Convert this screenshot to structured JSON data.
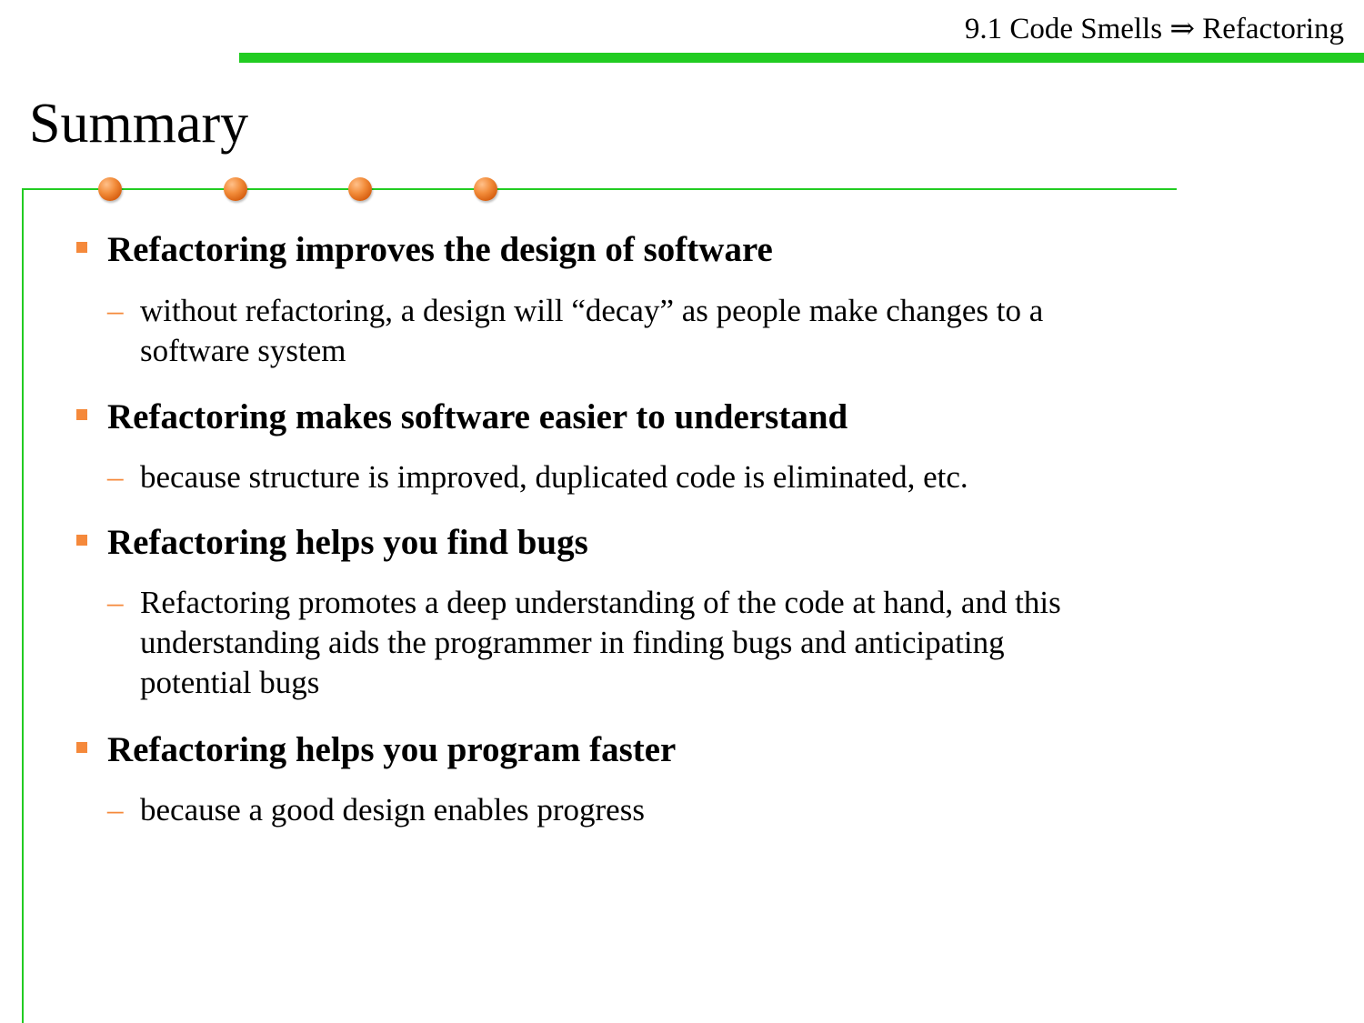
{
  "header": {
    "title": "9.1 Code Smells ⇒ Refactoring"
  },
  "slide": {
    "title": "Summary"
  },
  "colors": {
    "accent_green": "#22cc22",
    "bullet_orange": "#f5893b"
  },
  "points": [
    {
      "heading": "Refactoring improves the design of software",
      "detail_lines": [
        "without refactoring, a design will “decay” as people make changes to a",
        "software system"
      ]
    },
    {
      "heading": "Refactoring makes software easier to understand",
      "detail_lines": [
        "because structure is improved, duplicated code is eliminated, etc."
      ]
    },
    {
      "heading": "Refactoring helps you find bugs",
      "detail_lines": [
        "Refactoring promotes a deep understanding of the code at hand, and this",
        "understanding aids the programmer in finding bugs and anticipating",
        "potential bugs"
      ]
    },
    {
      "heading": "Refactoring helps you program faster",
      "detail_lines": [
        "because a good design enables progress"
      ]
    }
  ],
  "markers": {
    "dash": "–"
  }
}
